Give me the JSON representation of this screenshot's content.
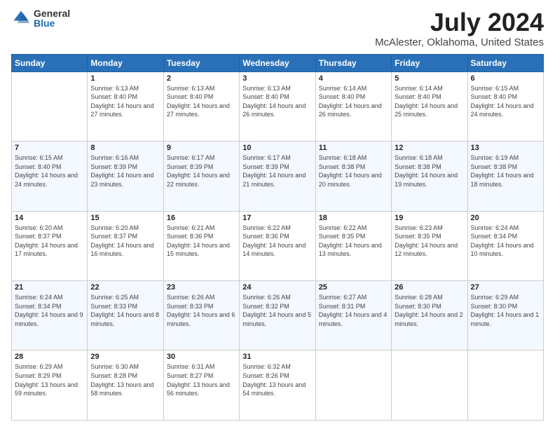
{
  "header": {
    "logo_general": "General",
    "logo_blue": "Blue",
    "title": "July 2024",
    "subtitle": "McAlester, Oklahoma, United States"
  },
  "days_of_week": [
    "Sunday",
    "Monday",
    "Tuesday",
    "Wednesday",
    "Thursday",
    "Friday",
    "Saturday"
  ],
  "weeks": [
    [
      {
        "num": "",
        "sunrise": "",
        "sunset": "",
        "daylight": ""
      },
      {
        "num": "1",
        "sunrise": "Sunrise: 6:13 AM",
        "sunset": "Sunset: 8:40 PM",
        "daylight": "Daylight: 14 hours and 27 minutes."
      },
      {
        "num": "2",
        "sunrise": "Sunrise: 6:13 AM",
        "sunset": "Sunset: 8:40 PM",
        "daylight": "Daylight: 14 hours and 27 minutes."
      },
      {
        "num": "3",
        "sunrise": "Sunrise: 6:13 AM",
        "sunset": "Sunset: 8:40 PM",
        "daylight": "Daylight: 14 hours and 26 minutes."
      },
      {
        "num": "4",
        "sunrise": "Sunrise: 6:14 AM",
        "sunset": "Sunset: 8:40 PM",
        "daylight": "Daylight: 14 hours and 26 minutes."
      },
      {
        "num": "5",
        "sunrise": "Sunrise: 6:14 AM",
        "sunset": "Sunset: 8:40 PM",
        "daylight": "Daylight: 14 hours and 25 minutes."
      },
      {
        "num": "6",
        "sunrise": "Sunrise: 6:15 AM",
        "sunset": "Sunset: 8:40 PM",
        "daylight": "Daylight: 14 hours and 24 minutes."
      }
    ],
    [
      {
        "num": "7",
        "sunrise": "Sunrise: 6:15 AM",
        "sunset": "Sunset: 8:40 PM",
        "daylight": "Daylight: 14 hours and 24 minutes."
      },
      {
        "num": "8",
        "sunrise": "Sunrise: 6:16 AM",
        "sunset": "Sunset: 8:39 PM",
        "daylight": "Daylight: 14 hours and 23 minutes."
      },
      {
        "num": "9",
        "sunrise": "Sunrise: 6:17 AM",
        "sunset": "Sunset: 8:39 PM",
        "daylight": "Daylight: 14 hours and 22 minutes."
      },
      {
        "num": "10",
        "sunrise": "Sunrise: 6:17 AM",
        "sunset": "Sunset: 8:39 PM",
        "daylight": "Daylight: 14 hours and 21 minutes."
      },
      {
        "num": "11",
        "sunrise": "Sunrise: 6:18 AM",
        "sunset": "Sunset: 8:38 PM",
        "daylight": "Daylight: 14 hours and 20 minutes."
      },
      {
        "num": "12",
        "sunrise": "Sunrise: 6:18 AM",
        "sunset": "Sunset: 8:38 PM",
        "daylight": "Daylight: 14 hours and 19 minutes."
      },
      {
        "num": "13",
        "sunrise": "Sunrise: 6:19 AM",
        "sunset": "Sunset: 8:38 PM",
        "daylight": "Daylight: 14 hours and 18 minutes."
      }
    ],
    [
      {
        "num": "14",
        "sunrise": "Sunrise: 6:20 AM",
        "sunset": "Sunset: 8:37 PM",
        "daylight": "Daylight: 14 hours and 17 minutes."
      },
      {
        "num": "15",
        "sunrise": "Sunrise: 6:20 AM",
        "sunset": "Sunset: 8:37 PM",
        "daylight": "Daylight: 14 hours and 16 minutes."
      },
      {
        "num": "16",
        "sunrise": "Sunrise: 6:21 AM",
        "sunset": "Sunset: 8:36 PM",
        "daylight": "Daylight: 14 hours and 15 minutes."
      },
      {
        "num": "17",
        "sunrise": "Sunrise: 6:22 AM",
        "sunset": "Sunset: 8:36 PM",
        "daylight": "Daylight: 14 hours and 14 minutes."
      },
      {
        "num": "18",
        "sunrise": "Sunrise: 6:22 AM",
        "sunset": "Sunset: 8:35 PM",
        "daylight": "Daylight: 14 hours and 13 minutes."
      },
      {
        "num": "19",
        "sunrise": "Sunrise: 6:23 AM",
        "sunset": "Sunset: 8:35 PM",
        "daylight": "Daylight: 14 hours and 12 minutes."
      },
      {
        "num": "20",
        "sunrise": "Sunrise: 6:24 AM",
        "sunset": "Sunset: 8:34 PM",
        "daylight": "Daylight: 14 hours and 10 minutes."
      }
    ],
    [
      {
        "num": "21",
        "sunrise": "Sunrise: 6:24 AM",
        "sunset": "Sunset: 8:34 PM",
        "daylight": "Daylight: 14 hours and 9 minutes."
      },
      {
        "num": "22",
        "sunrise": "Sunrise: 6:25 AM",
        "sunset": "Sunset: 8:33 PM",
        "daylight": "Daylight: 14 hours and 8 minutes."
      },
      {
        "num": "23",
        "sunrise": "Sunrise: 6:26 AM",
        "sunset": "Sunset: 8:33 PM",
        "daylight": "Daylight: 14 hours and 6 minutes."
      },
      {
        "num": "24",
        "sunrise": "Sunrise: 6:26 AM",
        "sunset": "Sunset: 8:32 PM",
        "daylight": "Daylight: 14 hours and 5 minutes."
      },
      {
        "num": "25",
        "sunrise": "Sunrise: 6:27 AM",
        "sunset": "Sunset: 8:31 PM",
        "daylight": "Daylight: 14 hours and 4 minutes."
      },
      {
        "num": "26",
        "sunrise": "Sunrise: 6:28 AM",
        "sunset": "Sunset: 8:30 PM",
        "daylight": "Daylight: 14 hours and 2 minutes."
      },
      {
        "num": "27",
        "sunrise": "Sunrise: 6:29 AM",
        "sunset": "Sunset: 8:30 PM",
        "daylight": "Daylight: 14 hours and 1 minute."
      }
    ],
    [
      {
        "num": "28",
        "sunrise": "Sunrise: 6:29 AM",
        "sunset": "Sunset: 8:29 PM",
        "daylight": "Daylight: 13 hours and 59 minutes."
      },
      {
        "num": "29",
        "sunrise": "Sunrise: 6:30 AM",
        "sunset": "Sunset: 8:28 PM",
        "daylight": "Daylight: 13 hours and 58 minutes."
      },
      {
        "num": "30",
        "sunrise": "Sunrise: 6:31 AM",
        "sunset": "Sunset: 8:27 PM",
        "daylight": "Daylight: 13 hours and 56 minutes."
      },
      {
        "num": "31",
        "sunrise": "Sunrise: 6:32 AM",
        "sunset": "Sunset: 8:26 PM",
        "daylight": "Daylight: 13 hours and 54 minutes."
      },
      {
        "num": "",
        "sunrise": "",
        "sunset": "",
        "daylight": ""
      },
      {
        "num": "",
        "sunrise": "",
        "sunset": "",
        "daylight": ""
      },
      {
        "num": "",
        "sunrise": "",
        "sunset": "",
        "daylight": ""
      }
    ]
  ]
}
